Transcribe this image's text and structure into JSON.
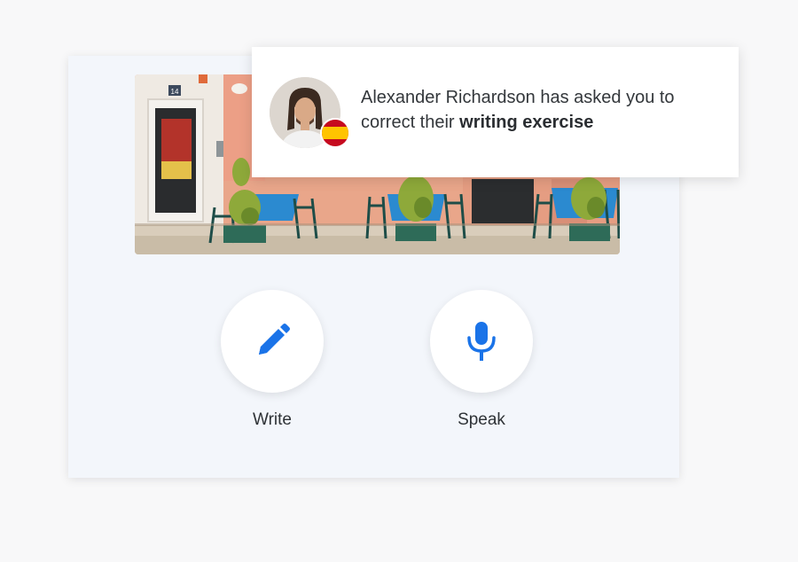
{
  "notification": {
    "user_name": "Alexander Richardson",
    "message_prefix": " has asked you to correct their ",
    "highlight": "writing exercise",
    "flag_country": "Spain",
    "avatar_icon": "user-avatar-photo",
    "flag_icon": "spain-flag-icon"
  },
  "scene": {
    "door_number": "14",
    "image_name": "street-cafe-photo"
  },
  "actions": {
    "write": {
      "label": "Write",
      "icon": "pencil-icon"
    },
    "speak": {
      "label": "Speak",
      "icon": "microphone-icon"
    }
  },
  "colors": {
    "accent": "#1a73e8",
    "card_bg": "#f3f6fb",
    "page_bg": "#f8f8f9",
    "text": "#33373b"
  }
}
